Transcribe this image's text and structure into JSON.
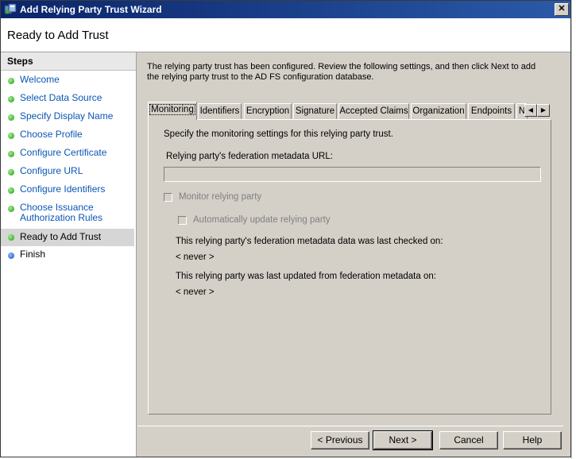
{
  "window": {
    "title": "Add Relying Party Trust Wizard",
    "close_label": "✕"
  },
  "header": {
    "title": "Ready to Add Trust"
  },
  "steps": {
    "heading": "Steps",
    "items": [
      {
        "label": "Welcome",
        "status": "done"
      },
      {
        "label": "Select Data Source",
        "status": "done"
      },
      {
        "label": "Specify Display Name",
        "status": "done"
      },
      {
        "label": "Choose Profile",
        "status": "done"
      },
      {
        "label": "Configure Certificate",
        "status": "done"
      },
      {
        "label": "Configure URL",
        "status": "done"
      },
      {
        "label": "Configure Identifiers",
        "status": "done"
      },
      {
        "label": "Choose Issuance Authorization Rules",
        "status": "done"
      },
      {
        "label": "Ready to Add Trust",
        "status": "current"
      },
      {
        "label": "Finish",
        "status": "pending"
      }
    ]
  },
  "content": {
    "description": "The relying party trust has been configured. Review the following settings, and then click Next to add the relying party trust to the AD FS configuration database.",
    "tabs": [
      "Monitoring",
      "Identifiers",
      "Encryption",
      "Signature",
      "Accepted Claims",
      "Organization",
      "Endpoints",
      "N"
    ],
    "tab_prev": "◀",
    "tab_next": "▶",
    "panel": {
      "intro": "Specify the monitoring settings for this relying party trust.",
      "url_label": "Relying party's federation metadata URL:",
      "url_value": "",
      "monitor_label": "Monitor relying party",
      "auto_update_label": "Automatically update relying party",
      "last_checked_label": "This relying party's federation metadata data was last checked on:",
      "last_checked_value": "< never >",
      "last_updated_label": "This relying party was last updated from federation metadata on:",
      "last_updated_value": "< never >"
    }
  },
  "footer": {
    "previous": "< Previous",
    "next": "Next >",
    "cancel": "Cancel",
    "help": "Help"
  },
  "colors": {
    "titlebar": "#0a246a",
    "link": "#0b56b5",
    "step_done": "#1f9a14",
    "step_pending": "#1b52d6"
  }
}
